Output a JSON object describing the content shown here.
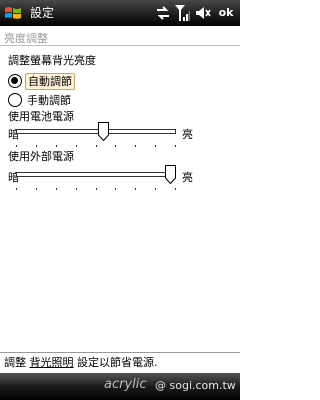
{
  "titlebar": {
    "title": "設定",
    "ok_label": "ok",
    "icons": [
      "windows-start-icon",
      "connectivity-icon",
      "signal-icon",
      "volume-icon"
    ]
  },
  "page": {
    "title": "亮度調整"
  },
  "backlight": {
    "section_title": "調整螢幕背光亮度",
    "options": [
      {
        "label": "自動調節",
        "checked": true
      },
      {
        "label": "手動調節",
        "checked": false
      }
    ],
    "battery": {
      "label": "使用電池電源",
      "dark_label": "暗",
      "bright_label": "亮",
      "level": 0.55
    },
    "external": {
      "label": "使用外部電源",
      "dark_label": "暗",
      "bright_label": "亮",
      "level": 1.0
    },
    "tick_count": 9
  },
  "help": {
    "prefix": "調整",
    "link": "背光照明",
    "suffix": "設定以節省電源."
  },
  "watermark": {
    "brand": "acrylic",
    "site": "@ sogi.com.tw"
  }
}
